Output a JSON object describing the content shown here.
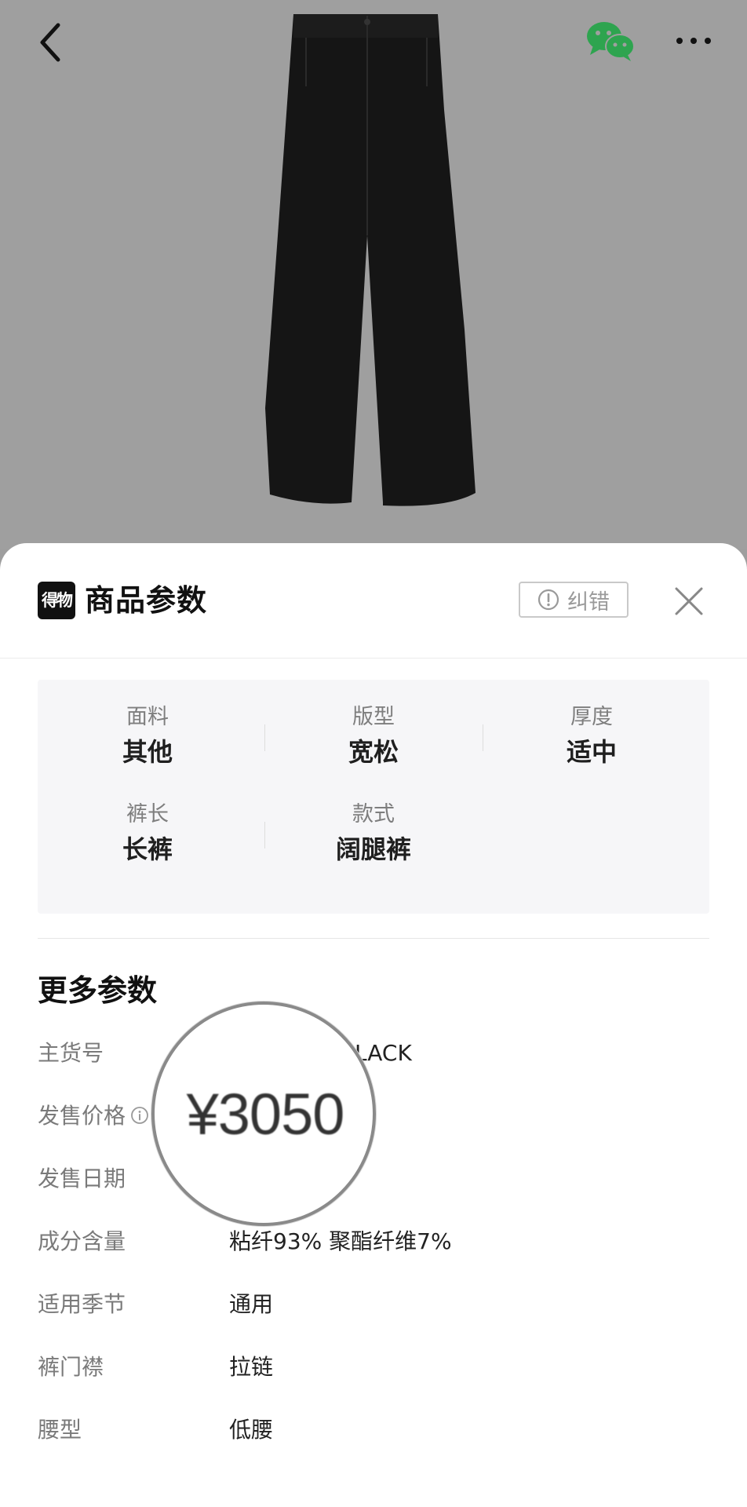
{
  "nav": {
    "back_icon": "back-chevron-icon",
    "share_icon": "wechat-icon",
    "more_icon": "more-dots-icon"
  },
  "sheet": {
    "brand": "得物",
    "title": "商品参数",
    "correct_label": "纠错",
    "close_icon": "close-icon"
  },
  "params": [
    {
      "label": "面料",
      "value": "其他"
    },
    {
      "label": "版型",
      "value": "宽松"
    },
    {
      "label": "厚度",
      "value": "适中"
    },
    {
      "label": "裤长",
      "value": "长裤"
    },
    {
      "label": "款式",
      "value": "阔腿裤"
    }
  ],
  "more": {
    "title": "更多参数",
    "rows": [
      {
        "label": "主货号",
        "value": "LACK"
      },
      {
        "label": "发售价格",
        "value": ""
      },
      {
        "label": "发售日期",
        "value": ""
      },
      {
        "label": "成分含量",
        "value": "粘纤93% 聚酯纤维7%"
      },
      {
        "label": "适用季节",
        "value": "通用"
      },
      {
        "label": "裤门襟",
        "value": "拉链"
      },
      {
        "label": "腰型",
        "value": "低腰"
      }
    ]
  },
  "magnifier": {
    "text": "¥3050"
  },
  "colors": {
    "backdrop": "#9f9f9f",
    "wechat_green": "#2ea44f",
    "param_bg": "#f6f6f8"
  }
}
